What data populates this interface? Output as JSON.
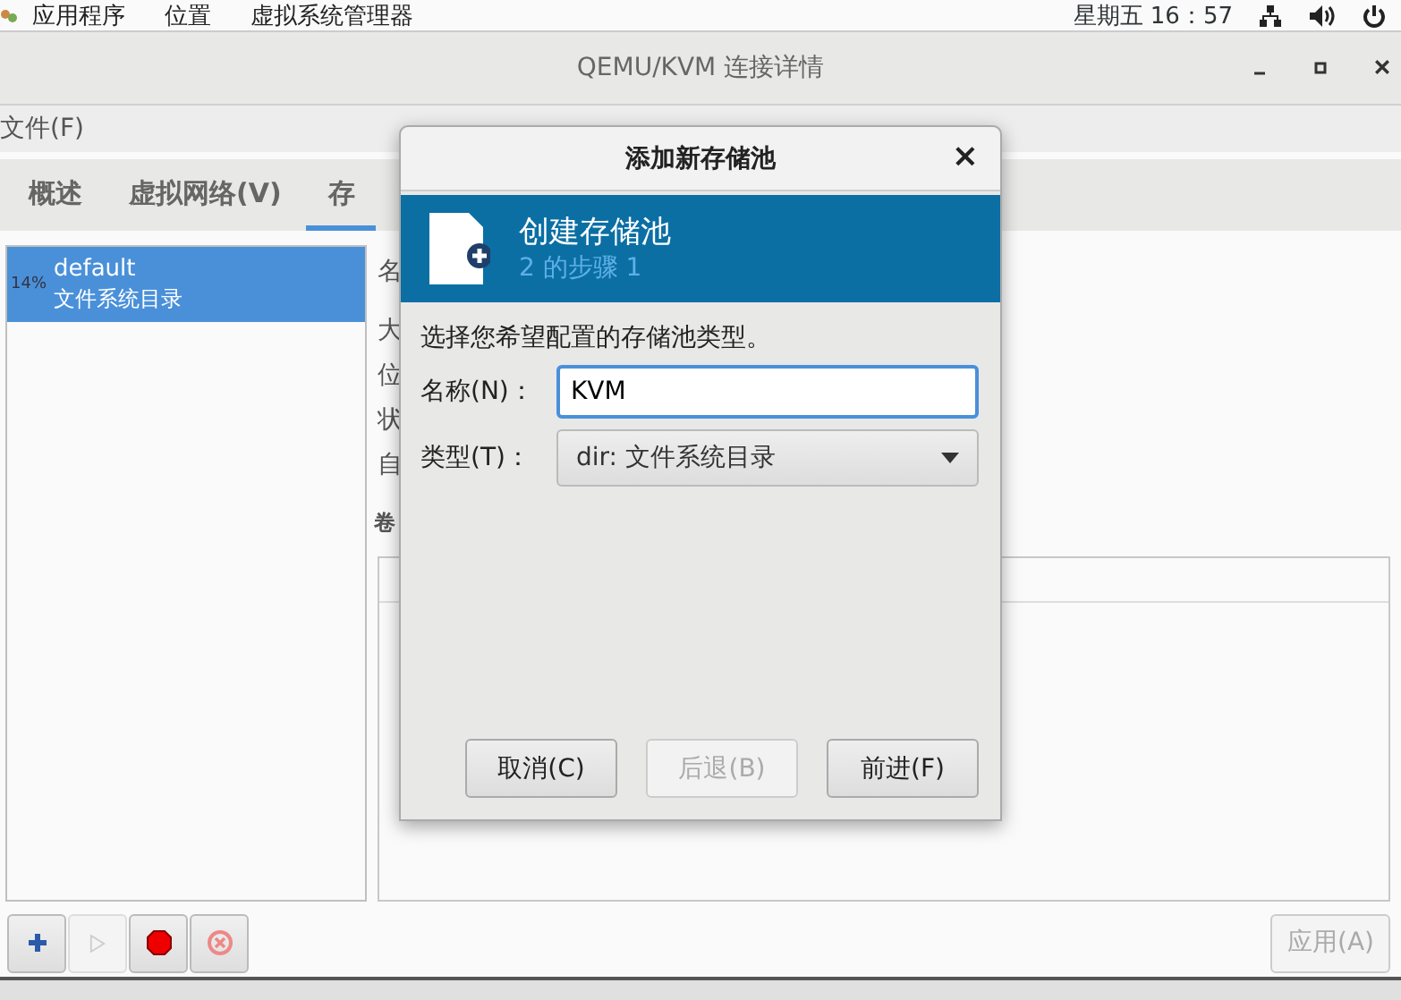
{
  "top_bar": {
    "menus": [
      "应用程序",
      "位置",
      "虚拟系统管理器"
    ],
    "clock": "星期五 16：57"
  },
  "window": {
    "title": "QEMU/KVM 连接详情"
  },
  "menu_bar": [
    "文件(F)"
  ],
  "tabs": [
    {
      "label": "概述",
      "selected": false
    },
    {
      "label": "虚拟网络(V)",
      "selected": false
    },
    {
      "label": "存",
      "selected": true
    }
  ],
  "pools": [
    {
      "usage": "14%",
      "name": "default",
      "type": "文件系统目录",
      "selected": true
    }
  ],
  "details": {
    "labels": [
      "名",
      "大",
      "位",
      "状",
      "自"
    ],
    "section": "卷"
  },
  "toolbar": [
    {
      "kind": "add",
      "disabled": false
    },
    {
      "kind": "start",
      "disabled": true
    },
    {
      "kind": "stop",
      "disabled": false
    },
    {
      "kind": "delete",
      "disabled": false
    }
  ],
  "apply_button": {
    "label": "应用(A)",
    "disabled": true
  },
  "dialog": {
    "title": "添加新存储池",
    "close": "×",
    "heading": "创建存储池",
    "step": "2 的步骤 1",
    "prompt": "选择您希望配置的存储池类型。",
    "name_label": "名称(N)：",
    "name_value": "KVM",
    "type_label": "类型(T)：",
    "type_value": "dir: 文件系统目录",
    "buttons": [
      {
        "label": "取消(C)",
        "disabled": false
      },
      {
        "label": "后退(B)",
        "disabled": true
      },
      {
        "label": "前进(F)",
        "disabled": false
      }
    ]
  }
}
